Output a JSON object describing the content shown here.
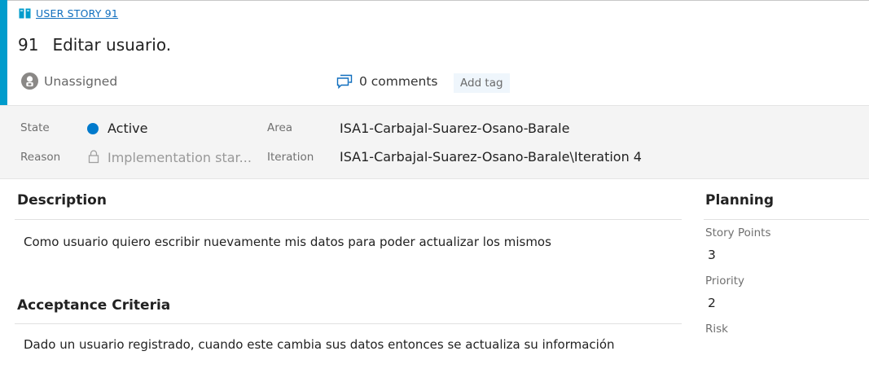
{
  "work_item": {
    "type_label": "USER STORY 91",
    "id": "91",
    "title": "Editar usuario.",
    "accent_color": "#009ccc"
  },
  "header": {
    "assignee": "Unassigned",
    "comments": "0 comments",
    "add_tag": "Add tag"
  },
  "fields": {
    "state_label": "State",
    "state_value": "Active",
    "state_color": "#007acc",
    "reason_label": "Reason",
    "reason_value": "Implementation star...",
    "area_label": "Area",
    "area_value": "ISA1-Carbajal-Suarez-Osano-Barale",
    "iteration_label": "Iteration",
    "iteration_value": "ISA1-Carbajal-Suarez-Osano-Barale\\Iteration 4"
  },
  "description": {
    "title": "Description",
    "text": "Como usuario quiero escribir nuevamente mis datos para poder actualizar los mismos"
  },
  "acceptance": {
    "title": "Acceptance Criteria",
    "text": "Dado un usuario registrado, cuando este cambia sus datos entonces se actualiza su información"
  },
  "planning": {
    "title": "Planning",
    "story_points_label": "Story Points",
    "story_points_value": "3",
    "priority_label": "Priority",
    "priority_value": "2",
    "risk_label": "Risk"
  }
}
